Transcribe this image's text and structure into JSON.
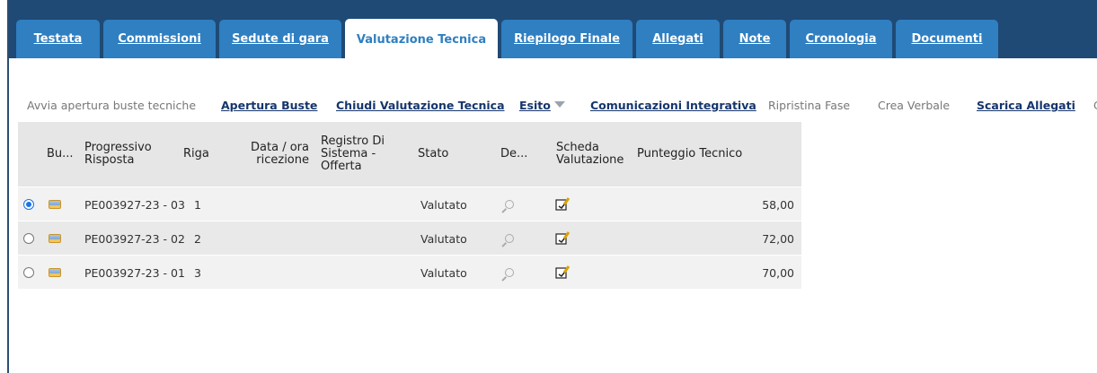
{
  "tabs": [
    {
      "label": "Testata",
      "active": false
    },
    {
      "label": "Commissioni",
      "active": false
    },
    {
      "label": "Sedute di gara",
      "active": false
    },
    {
      "label": "Valutazione Tecnica",
      "active": true
    },
    {
      "label": "Riepilogo Finale",
      "active": false
    },
    {
      "label": "Allegati",
      "active": false
    },
    {
      "label": "Note",
      "active": false
    },
    {
      "label": "Cronologia",
      "active": false
    },
    {
      "label": "Documenti",
      "active": false
    }
  ],
  "toolbar": {
    "avvia": "Avvia apertura buste tecniche",
    "apertura": "Apertura Buste",
    "chiudi": "Chiudi Valutazione Tecnica",
    "esito": "Esito",
    "comunicazioni": "Comunicazioni Integrativa",
    "ripristina": "Ripristina Fase",
    "crea": "Crea Verbale",
    "scarica": "Scarica Allegati",
    "overflow": "C"
  },
  "table": {
    "headers": {
      "busta": "Bu...",
      "progressivo": "Progressivo Risposta",
      "riga": "Riga",
      "data": "Data / ora ricezione",
      "registro": "Registro Di Sistema - Offerta",
      "stato": "Stato",
      "dettaglio": "De...",
      "scheda": "Scheda Valutazione",
      "punteggio": "Punteggio Tecnico"
    },
    "rows": [
      {
        "selected": true,
        "progressivo": "PE003927-23 - 03",
        "riga": "1",
        "stato": "Valutato",
        "punteggio": "58,00"
      },
      {
        "selected": false,
        "progressivo": "PE003927-23 - 02",
        "riga": "2",
        "stato": "Valutato",
        "punteggio": "72,00"
      },
      {
        "selected": false,
        "progressivo": "PE003927-23 - 01",
        "riga": "3",
        "stato": "Valutato",
        "punteggio": "70,00"
      }
    ]
  },
  "colors": {
    "tabbar": "#1f4a75",
    "tab": "#2f7fc1",
    "link": "#16356b",
    "header_bg": "#e6e6e6"
  }
}
